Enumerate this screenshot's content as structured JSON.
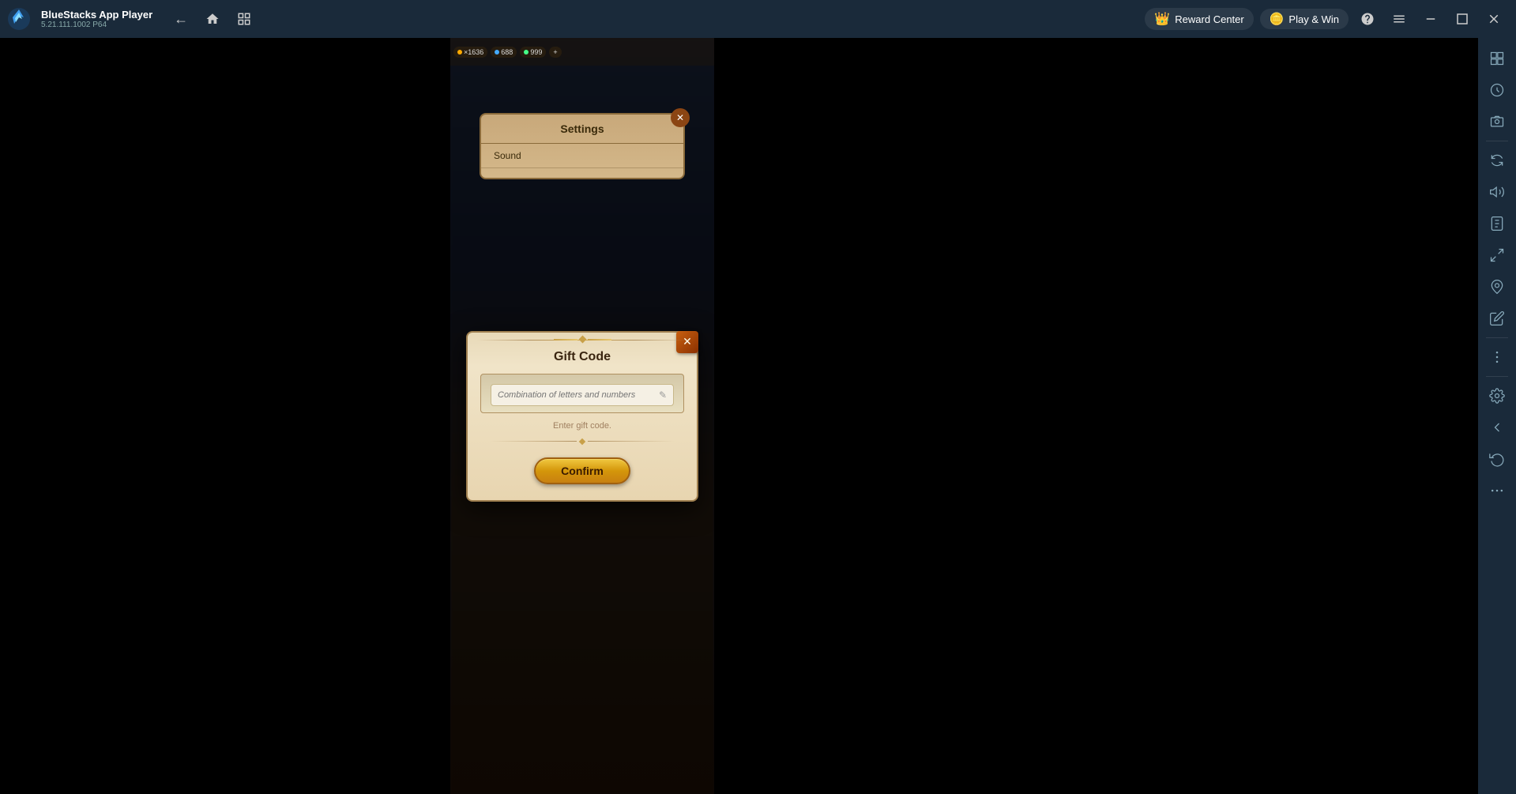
{
  "titlebar": {
    "app_name": "BlueStacks App Player",
    "version": "5.21.111.1002  P64",
    "back_label": "←",
    "home_label": "⌂",
    "tab_label": "⧉",
    "reward_center_label": "Reward Center",
    "play_win_label": "Play & Win",
    "help_label": "?",
    "menu_label": "≡",
    "minimize_label": "—",
    "maximize_label": "□",
    "close_label": "✕"
  },
  "game": {
    "settings_title": "Settings",
    "settings_subtitle": "Sound"
  },
  "gift_code_dialog": {
    "title": "Gift Code",
    "input_placeholder": "Combination of letters and numbers",
    "input_hint": "Enter gift code.",
    "confirm_label": "Confirm",
    "close_symbol": "✕",
    "edit_symbol": "✎"
  },
  "right_sidebar": {
    "icons": [
      {
        "name": "sidebar-icon-1",
        "symbol": "⧉"
      },
      {
        "name": "sidebar-icon-2",
        "symbol": "⊞"
      },
      {
        "name": "sidebar-icon-3",
        "symbol": "◎"
      },
      {
        "name": "sidebar-icon-4",
        "symbol": "⊕"
      },
      {
        "name": "sidebar-icon-5",
        "symbol": "▤"
      },
      {
        "name": "sidebar-icon-6",
        "symbol": "⇄"
      },
      {
        "name": "sidebar-icon-7",
        "symbol": "⊙"
      },
      {
        "name": "sidebar-icon-8",
        "symbol": "⬚"
      },
      {
        "name": "sidebar-icon-9",
        "symbol": "✎"
      },
      {
        "name": "sidebar-icon-10",
        "symbol": "…"
      },
      {
        "name": "sidebar-icon-settings",
        "symbol": "⚙"
      },
      {
        "name": "sidebar-icon-panel",
        "symbol": "◁"
      },
      {
        "name": "sidebar-icon-refresh",
        "symbol": "↺"
      },
      {
        "name": "sidebar-icon-more",
        "symbol": "⋮"
      }
    ]
  }
}
